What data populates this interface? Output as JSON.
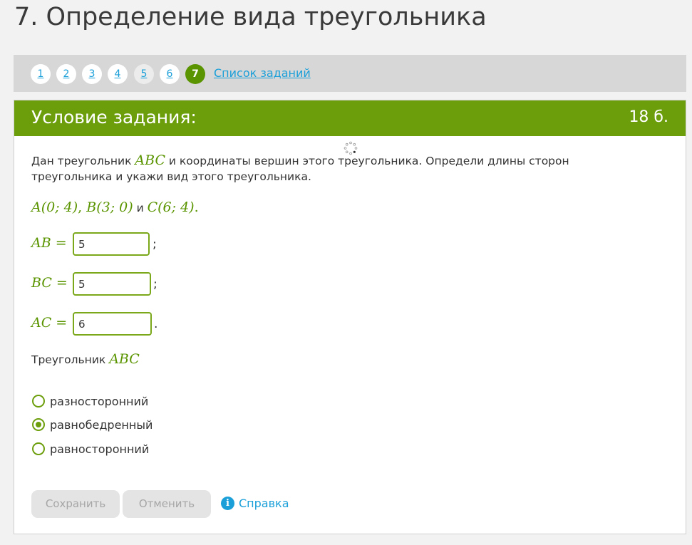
{
  "page": {
    "title": "7. Определение вида треугольника"
  },
  "nav": {
    "items": [
      "1",
      "2",
      "3",
      "4",
      "5",
      "6",
      "7"
    ],
    "current": "7",
    "task_list_link": "Список заданий"
  },
  "task": {
    "header": "Условие задания:",
    "score": "18 б.",
    "intro_before": "Дан треугольник ",
    "intro_math": "ABC",
    "intro_after": " и координаты вершин этого треугольника. Определи длины сторон треугольника и укажи вид этого треугольника.",
    "coords": {
      "a": "A(0; 4)",
      "sep": ", ",
      "b": "B(3; 0)",
      "and": " и ",
      "c": "C(6; 4)",
      "end": "."
    },
    "equations": [
      {
        "label": "AB =",
        "value": "5",
        "punct": ";"
      },
      {
        "label": "BC =",
        "value": "5",
        "punct": ";"
      },
      {
        "label": "AC =",
        "value": "6",
        "punct": "."
      }
    ],
    "triangle_label": "Треугольник ",
    "triangle_math": "ABC",
    "options": [
      {
        "label": "разносторонний",
        "checked": false
      },
      {
        "label": "равнобедренный",
        "checked": true
      },
      {
        "label": "равносторонний",
        "checked": false
      }
    ]
  },
  "actions": {
    "save": "Сохранить",
    "cancel": "Отменить",
    "help_icon_glyph": "i",
    "help": "Справка"
  },
  "colors": {
    "accent_green": "#6c9e0c",
    "link_blue": "#1a9fd9"
  }
}
